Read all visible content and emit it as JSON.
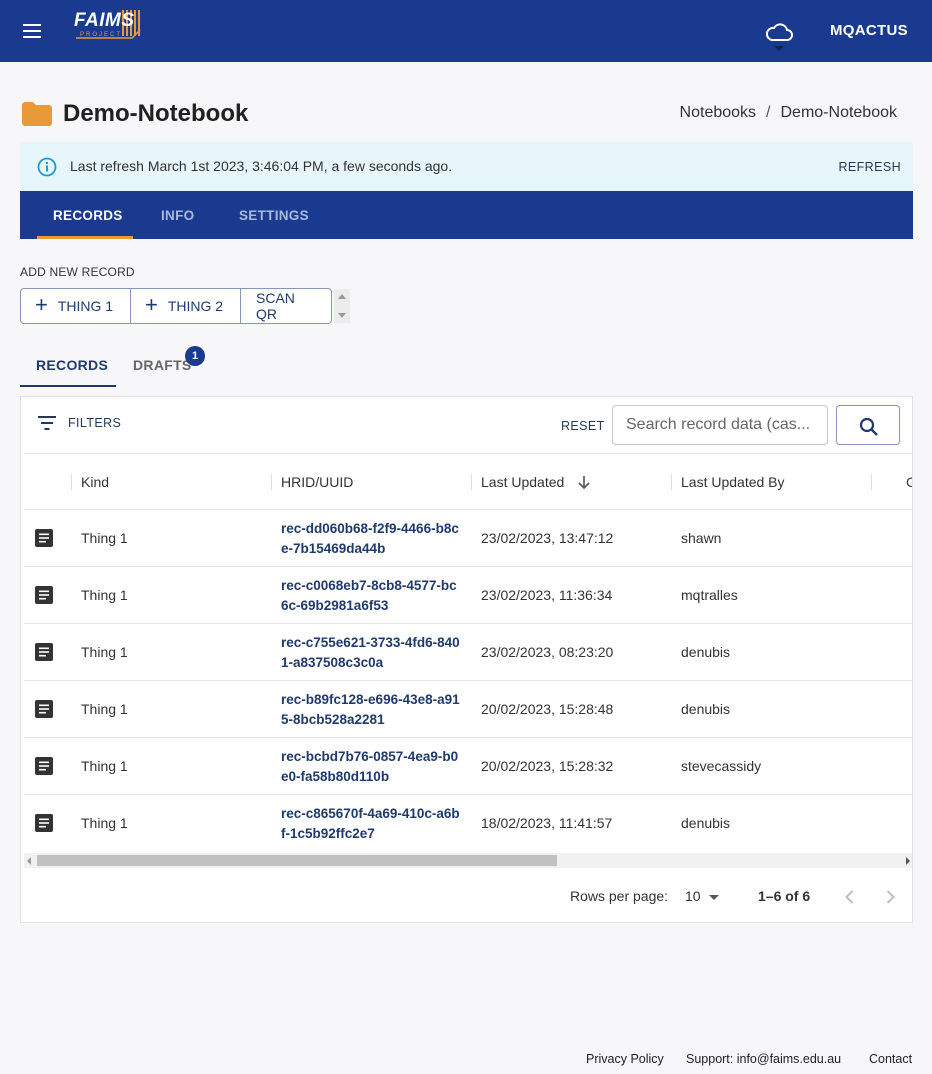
{
  "appbar": {
    "logo_text": "FAIMS",
    "logo_sub": "PROJECT",
    "user": "MQACTUS",
    "bg_color": "#1a3a8f"
  },
  "header": {
    "title": "Demo-Notebook",
    "breadcrumb": [
      "Notebooks",
      "/",
      "Demo-Notebook"
    ]
  },
  "alert": {
    "message": "Last refresh March 1st 2023, 3:46:04 PM, a few seconds ago.",
    "action": "REFRESH"
  },
  "main_tabs": [
    {
      "label": "RECORDS",
      "active": true
    },
    {
      "label": "INFO",
      "active": false
    },
    {
      "label": "SETTINGS",
      "active": false
    }
  ],
  "add_record": {
    "label": "ADD NEW RECORD",
    "buttons": [
      "THING 1",
      "THING 2",
      "SCAN QR"
    ]
  },
  "sub_tabs": [
    {
      "label": "RECORDS",
      "active": true
    },
    {
      "label": "DRAFTS",
      "active": false,
      "badge": "1"
    }
  ],
  "toolbar": {
    "filters": "FILTERS",
    "reset": "RESET",
    "search_placeholder": "Search record data (cas..."
  },
  "table": {
    "columns": [
      "Kind",
      "HRID/UUID",
      "Last Updated",
      "Last Updated By",
      "C"
    ],
    "rows": [
      {
        "kind": "Thing 1",
        "hrid": "rec-dd060b68-f2f9-4466-b8ce-7b15469da44b",
        "updated": "23/02/2023, 13:47:12",
        "by": "shawn"
      },
      {
        "kind": "Thing 1",
        "hrid": "rec-c0068eb7-8cb8-4577-bc6c-69b2981a6f53",
        "updated": "23/02/2023, 11:36:34",
        "by": "mqtralles"
      },
      {
        "kind": "Thing 1",
        "hrid": "rec-c755e621-3733-4fd6-8401-a837508c3c0a",
        "updated": "23/02/2023, 08:23:20",
        "by": "denubis"
      },
      {
        "kind": "Thing 1",
        "hrid": "rec-b89fc128-e696-43e8-a915-8bcb528a2281",
        "updated": "20/02/2023, 15:28:48",
        "by": "denubis"
      },
      {
        "kind": "Thing 1",
        "hrid": "rec-bcbd7b76-0857-4ea9-b0e0-fa58b80d110b",
        "updated": "20/02/2023, 15:28:32",
        "by": "stevecassidy"
      },
      {
        "kind": "Thing 1",
        "hrid": "rec-c865670f-4a69-410c-a6bf-1c5b92ffc2e7",
        "updated": "18/02/2023, 11:41:57",
        "by": "denubis"
      }
    ]
  },
  "pagination": {
    "rows_label": "Rows per page:",
    "rows_value": "10",
    "range": "1–6 of 6"
  },
  "footer": {
    "privacy": "Privacy Policy",
    "support": "Support: info@faims.edu.au",
    "contact": "Contact"
  }
}
